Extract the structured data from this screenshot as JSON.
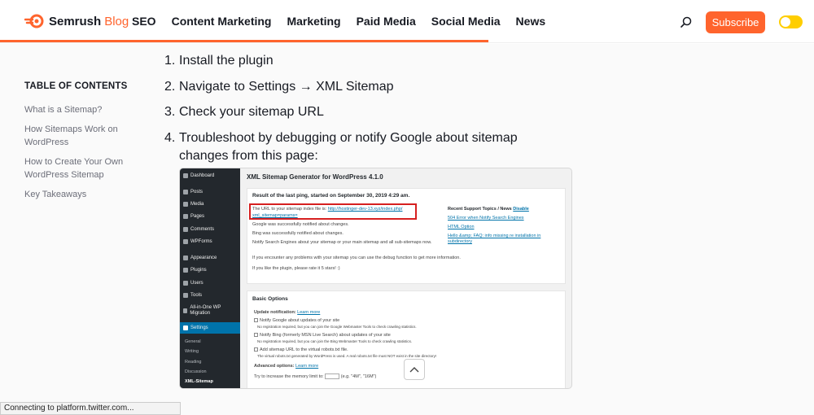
{
  "header": {
    "brand": "Semrush",
    "brand_suffix": "Blog",
    "nav": [
      "SEO",
      "Content Marketing",
      "Marketing",
      "Paid Media",
      "Social Media",
      "News"
    ],
    "subscribe_label": "Subscribe"
  },
  "toc": {
    "title": "TABLE OF CONTENTS",
    "items": [
      "What is a Sitemap?",
      "How Sitemaps Work on WordPress",
      "How to Create Your Own WordPress Sitemap",
      "Key Takeaways"
    ]
  },
  "steps": [
    {
      "num": "1.",
      "text": "Install the plugin"
    },
    {
      "num": "2.",
      "text": "Navigate to Settings → XML Sitemap"
    },
    {
      "num": "3.",
      "text": "Check your sitemap URL"
    },
    {
      "num": "4.",
      "text": "Troubleshoot by debugging or notify Google about sitemap changes from this page:"
    }
  ],
  "screenshot": {
    "sidebar": [
      "Dashboard",
      "Posts",
      "Media",
      "Pages",
      "Comments",
      "WPForms",
      "Appearance",
      "Plugins",
      "Users",
      "Tools",
      "All-in-One WP Migration",
      "Settings"
    ],
    "sidebar_sub": [
      "General",
      "Writing",
      "Reading",
      "Discussion",
      "XML-Sitemap"
    ],
    "title": "XML Sitemap Generator for WordPress 4.1.0",
    "ping_heading": "Result of the last ping, started on September 30, 2019 4:29 am.",
    "url_line": "The URL to your sitemap index file is:",
    "url_link": "http://hostinger-dev-13.xyz/index.php/",
    "url_link2": "xml_sitemap=params=",
    "google_line": "Google was successfully notified about changes.",
    "bing_line": "Bing was successfully notified about changes.",
    "notify_line": "Notify Search Engines about your sitemap or your main sitemap and all sub-sitemaps now.",
    "problem_line": "If you encounter any problems with your sitemap you can use the debug function to get more information.",
    "rate_line": "If you like the plugin, please rate it 5 stars! :)",
    "support_title": "Recent Support Topics / News",
    "support_disable": "Disable",
    "support_items": [
      "504 Error when Notify Search Engines",
      "HTML Option",
      "Hello &amp; FAQ: info missing re installation in subdirectory"
    ],
    "basic_heading": "Basic Options",
    "update_notif": "Update notification:",
    "learn_more": "Learn more",
    "opt1": "Notify Google about updates of your site",
    "opt1_sub": "No registration required, but you can join the Google Webmaster Tools to check crawling statistics.",
    "opt2": "Notify Bing (formerly MSN Live Search) about updates of your site",
    "opt2_sub": "No registration required, but you can join the Bing Webmaster Tools to check crawling statistics.",
    "opt3": "Add sitemap URL to the virtual robots.txt file.",
    "opt3_sub": "The virtual robots.txt generated by WordPress is used. A real robots.txt file must NOT exist in the site directory!",
    "advanced": "Advanced options:",
    "memory": "Try to increase the memory limit to:",
    "memory_hint": "(e.g. \"4M\", \"16M\")"
  },
  "status_bar": "Connecting to platform.twitter.com..."
}
